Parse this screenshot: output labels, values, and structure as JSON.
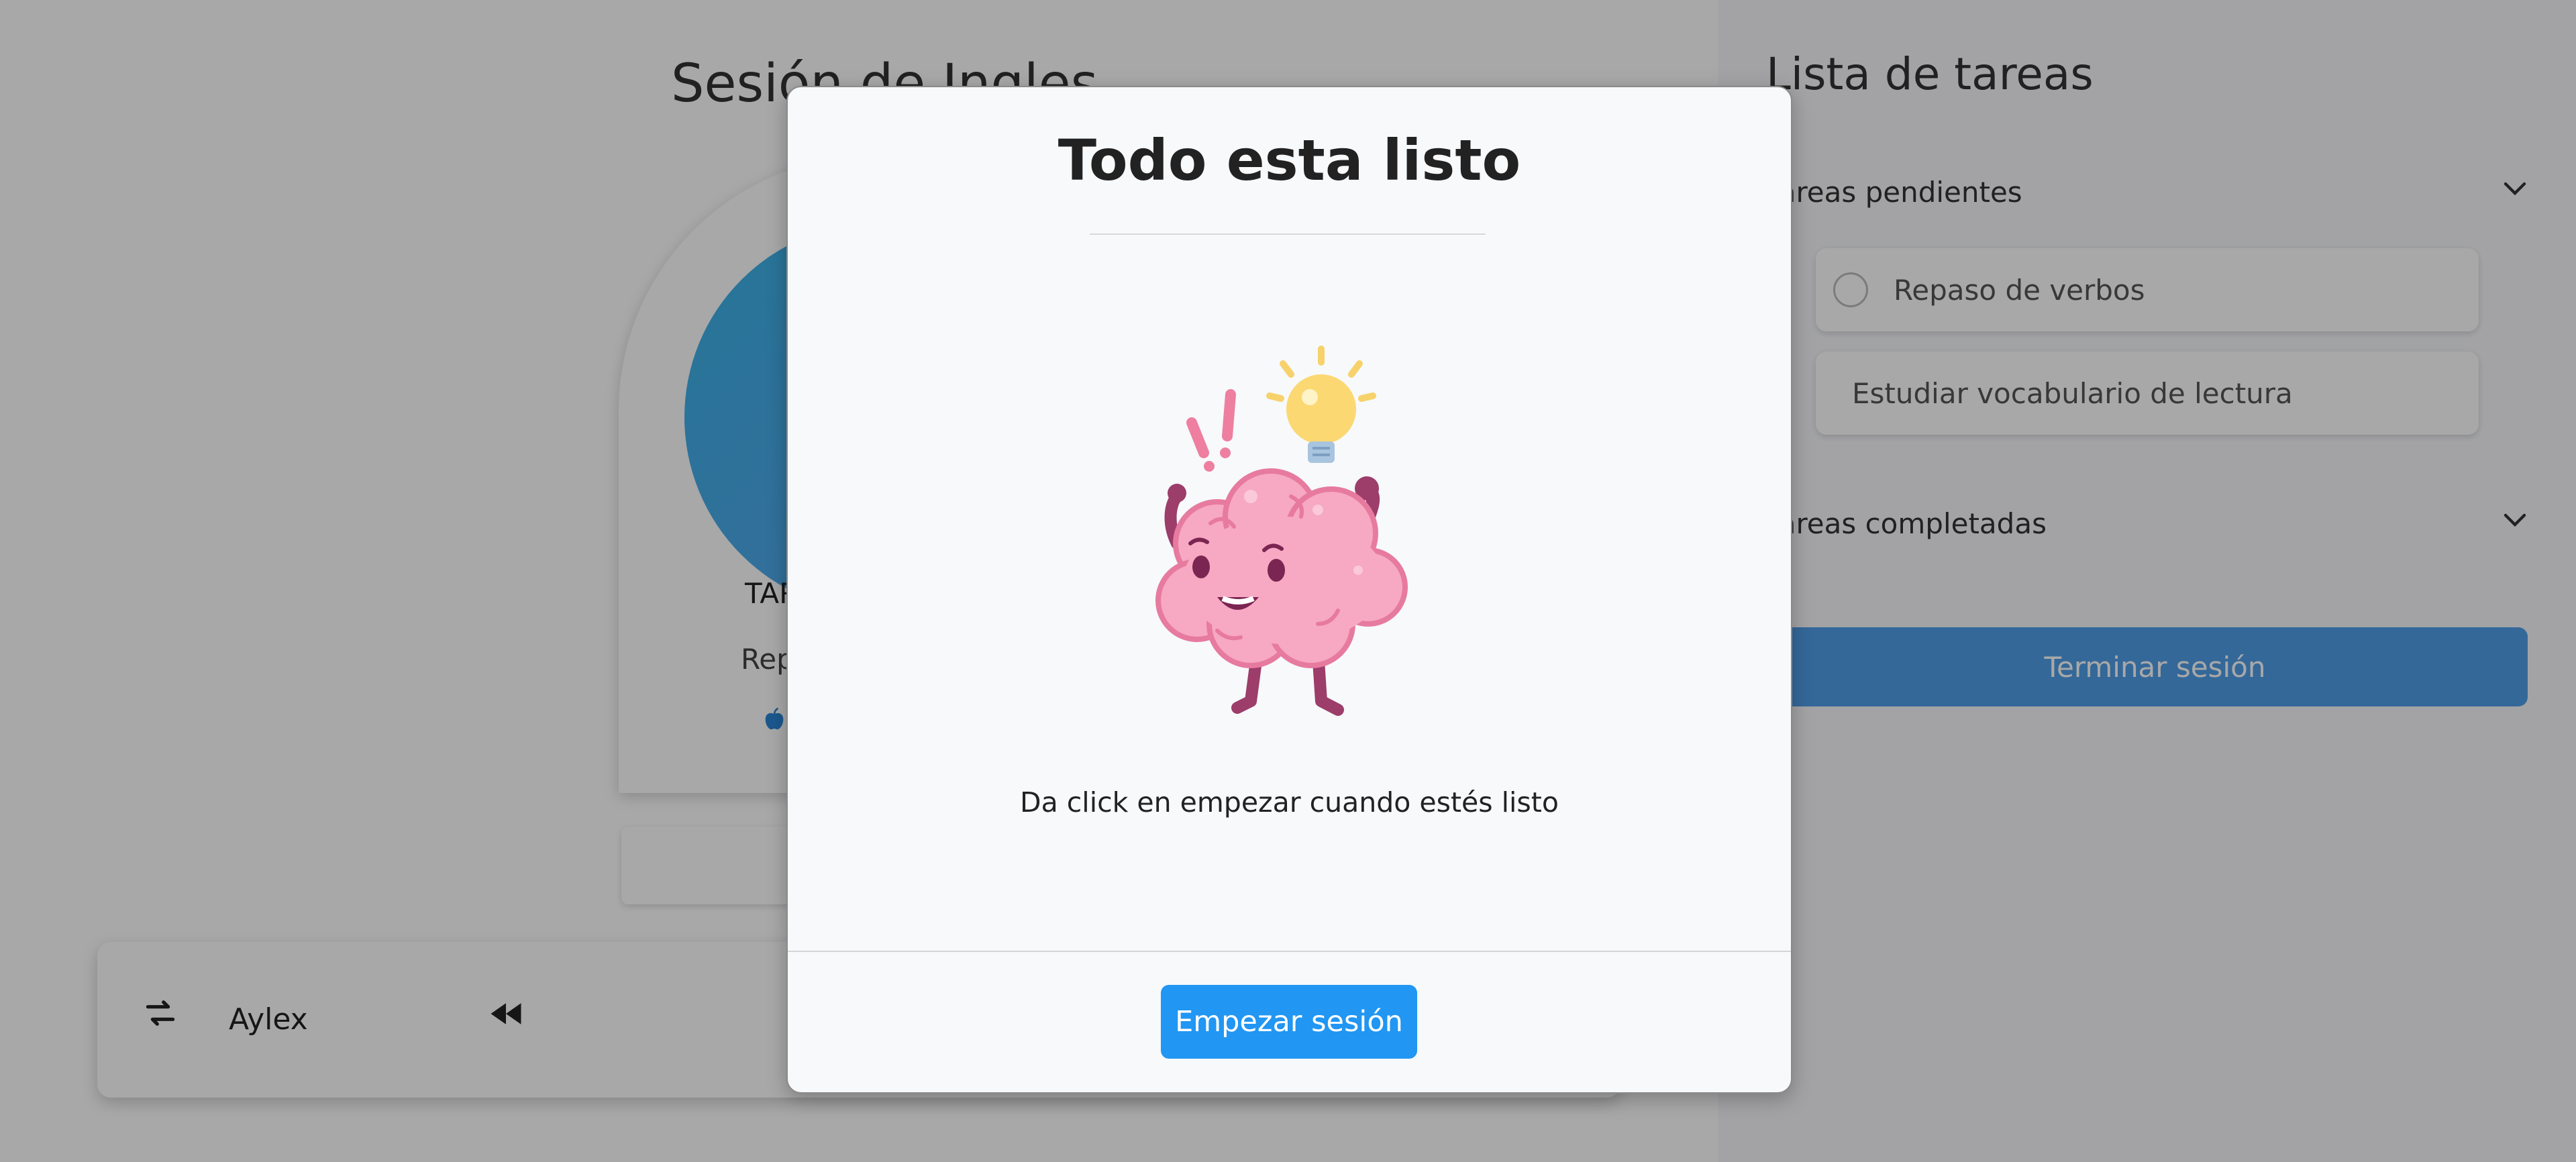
{
  "main": {
    "session_title": "Sesión de Ingles",
    "card": {
      "task_title": "TAR",
      "task_sub": "Rep",
      "icon": "apple-icon"
    },
    "player": {
      "shuffle_icon": "shuffle-icon",
      "name": "Aylex",
      "rewind_icon": "rewind-icon"
    }
  },
  "sidebar": {
    "title": "Lista de tareas",
    "pending_label": "Tareas pendientes",
    "completed_label": "Tareas completadas",
    "pending_tasks": [
      {
        "label": "Repaso de verbos",
        "has_checkbox": true
      },
      {
        "label": "Estudiar vocabulario de lectura",
        "has_checkbox": false
      }
    ],
    "end_button": "Terminar sesión"
  },
  "modal": {
    "title": "Todo esta listo",
    "message": "Da click en empezar cuando estés listo",
    "start_button": "Empezar sesión",
    "illustration": "brain-with-lightbulb"
  },
  "colors": {
    "primary": "#2196f3",
    "end_button": "#4f9ee8",
    "overlay": "rgba(0,0,0,0.34)"
  }
}
